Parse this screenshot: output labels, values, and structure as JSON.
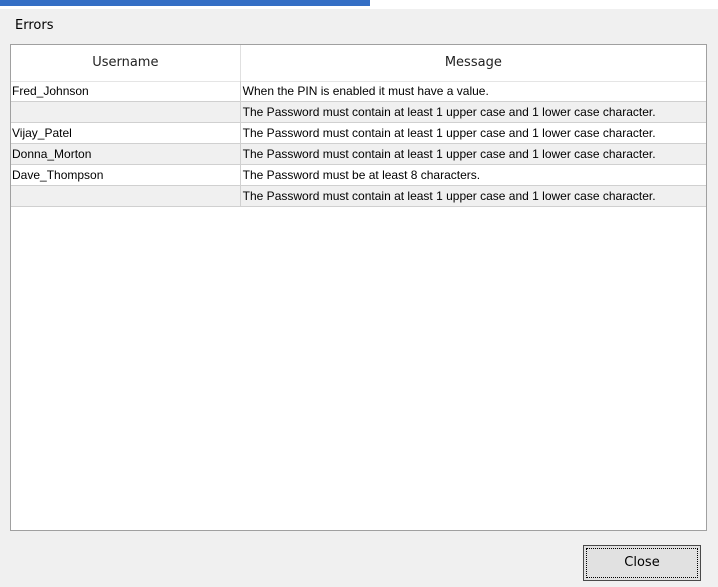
{
  "dialog": {
    "title": "Errors"
  },
  "grid": {
    "columns": [
      "Username",
      "Message"
    ],
    "rows": [
      {
        "username": "Fred_Johnson",
        "message": "When the PIN is enabled it must have a value."
      },
      {
        "username": "",
        "message": "The Password must contain at least 1 upper case and 1 lower case character."
      },
      {
        "username": "Vijay_Patel",
        "message": "The Password must contain at least 1 upper case and 1 lower case character."
      },
      {
        "username": "Donna_Morton",
        "message": "The Password must contain at least 1 upper case and 1 lower case character."
      },
      {
        "username": "Dave_Thompson",
        "message": "The Password must be at least 8 characters."
      },
      {
        "username": "",
        "message": "The Password must contain at least 1 upper case and 1 lower case character."
      }
    ]
  },
  "footer": {
    "close_label": "Close"
  }
}
